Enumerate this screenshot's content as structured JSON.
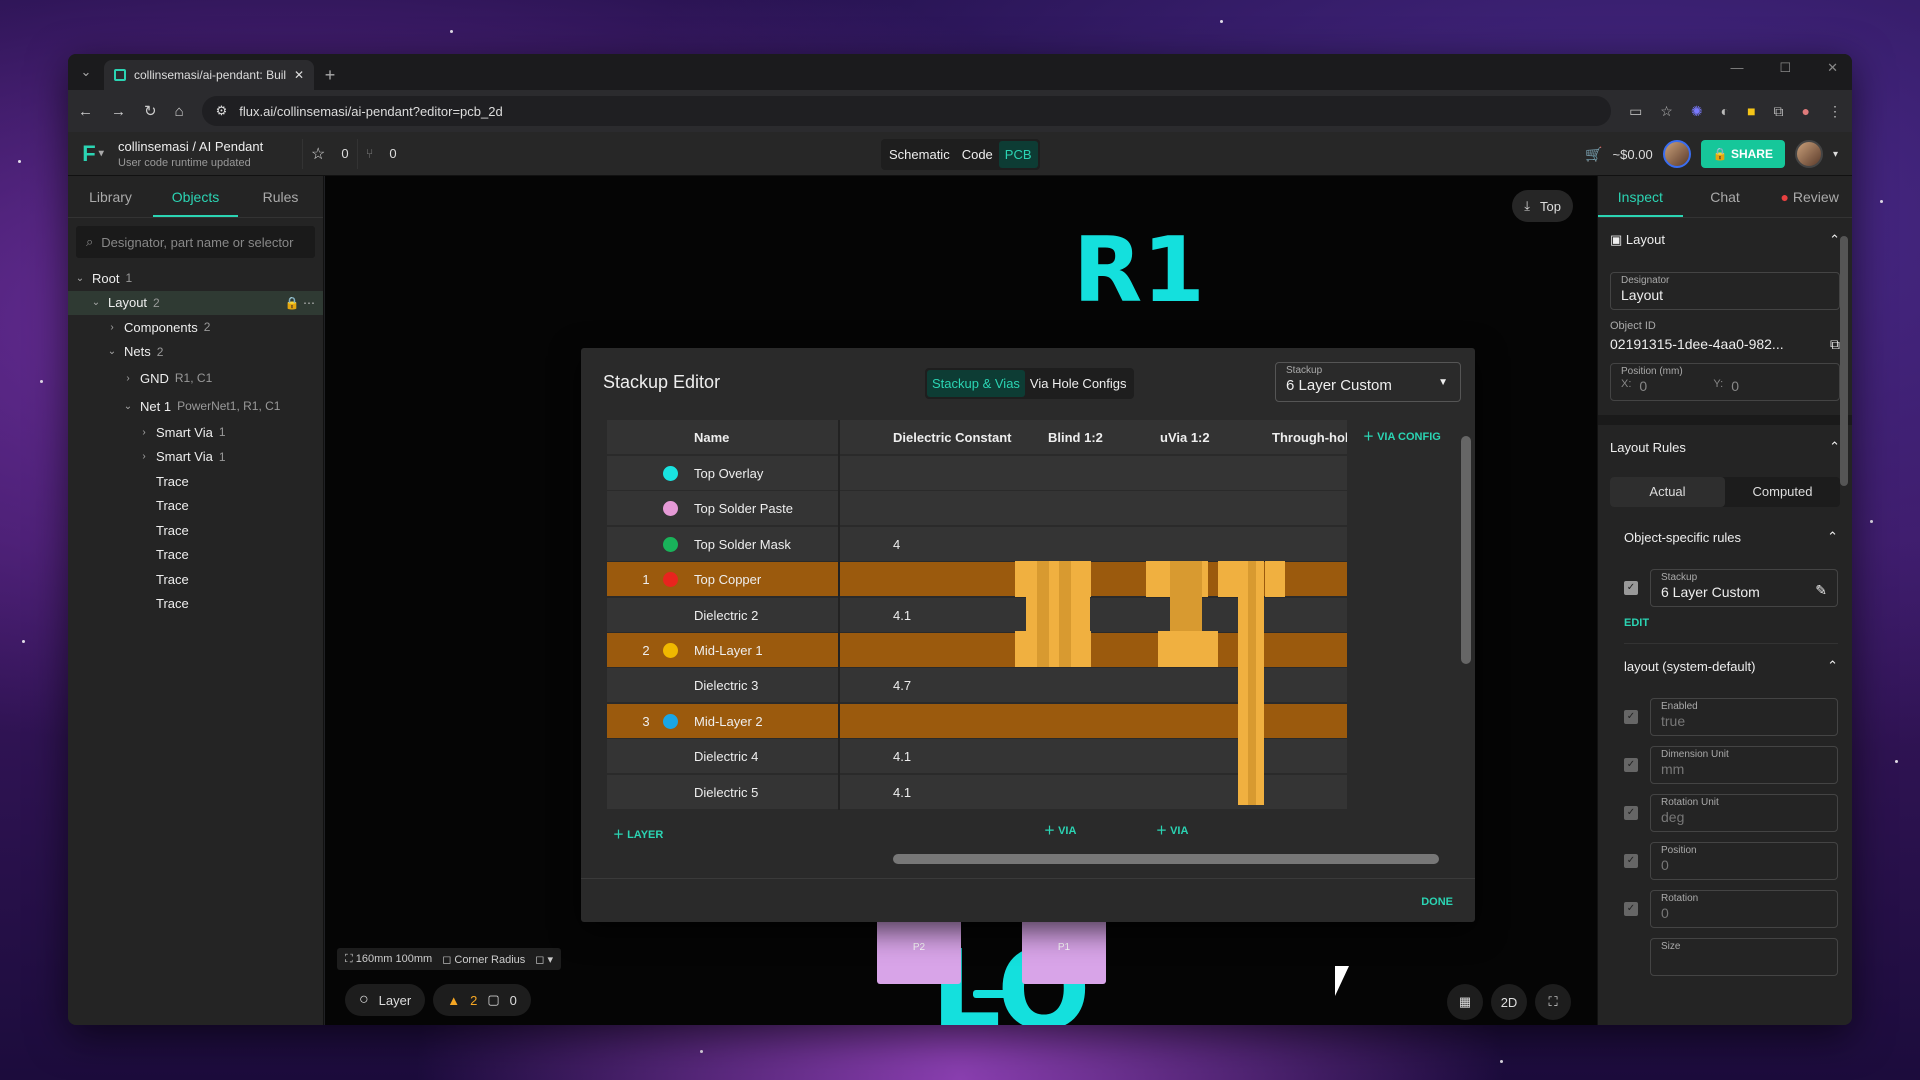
{
  "browser": {
    "tab_title": "collinsemasi/ai-pendant: Build",
    "url": "flux.ai/collinsemasi/ai-pendant?editor=pcb_2d"
  },
  "app": {
    "project_title": "collinsemasi / AI Pendant",
    "project_status": "User code runtime updated",
    "stars": "0",
    "forks": "0",
    "views": [
      "Schematic",
      "Code",
      "PCB"
    ],
    "active_view": "PCB",
    "cart_total": "~$0.00",
    "share_label": "SHARE"
  },
  "left_panel": {
    "tabs": [
      "Library",
      "Objects",
      "Rules"
    ],
    "active_tab": "Objects",
    "search_placeholder": "Designator, part name or selector",
    "tree": [
      {
        "label": "Root",
        "count": "1"
      },
      {
        "label": "Layout",
        "count": "2"
      },
      {
        "label": "Components",
        "count": "2"
      },
      {
        "label": "Nets",
        "count": "2"
      },
      {
        "label": "GND",
        "count": "R1, C1"
      },
      {
        "label": "Net 1",
        "count": "PowerNet1, R1, C1"
      },
      {
        "label": "Smart Via",
        "count": "1"
      },
      {
        "label": "Smart Via",
        "count": "1"
      },
      {
        "label": "Trace",
        "count": ""
      },
      {
        "label": "Trace",
        "count": ""
      },
      {
        "label": "Trace",
        "count": ""
      },
      {
        "label": "Trace",
        "count": ""
      },
      {
        "label": "Trace",
        "count": ""
      },
      {
        "label": "Trace",
        "count": ""
      }
    ]
  },
  "canvas": {
    "big_label_top": "R1",
    "big_label_bottom": "LO",
    "pad_left": "P2",
    "pad_right": "P1",
    "view_side": "Top",
    "board_size": "160mm 100mm",
    "corner_radius": "Corner Radius",
    "layer_label": "Layer",
    "warnings": "2",
    "comments": "0",
    "mode_2d": "2D"
  },
  "stackup_editor": {
    "title": "Stackup Editor",
    "tabs": [
      "Stackup & Vias",
      "Via Hole Configs"
    ],
    "active_tab": "Stackup & Vias",
    "stackup_label": "Stackup",
    "stackup_value": "6 Layer Custom",
    "columns": [
      "Name",
      "Dielectric Constant",
      "Blind 1:2",
      "uVia 1:2",
      "Through-hole"
    ],
    "rows": [
      {
        "num": "",
        "color": "#19e3e0",
        "name": "Top Overlay",
        "dc": "",
        "copper": false
      },
      {
        "num": "",
        "color": "#e59ad6",
        "name": "Top Solder Paste",
        "dc": "",
        "copper": false
      },
      {
        "num": "",
        "color": "#19b35a",
        "name": "Top Solder Mask",
        "dc": "4",
        "copper": false
      },
      {
        "num": "1",
        "color": "#e8241e",
        "name": "Top Copper",
        "dc": "",
        "copper": true
      },
      {
        "num": "",
        "color": "",
        "name": "Dielectric 2",
        "dc": "4.1",
        "copper": false
      },
      {
        "num": "2",
        "color": "#f0b800",
        "name": "Mid-Layer 1",
        "dc": "",
        "copper": true
      },
      {
        "num": "",
        "color": "",
        "name": "Dielectric 3",
        "dc": "4.7",
        "copper": false
      },
      {
        "num": "3",
        "color": "#1aa6e6",
        "name": "Mid-Layer 2",
        "dc": "",
        "copper": true
      },
      {
        "num": "",
        "color": "",
        "name": "Dielectric 4",
        "dc": "4.1",
        "copper": false
      },
      {
        "num": "",
        "color": "",
        "name": "Dielectric 5",
        "dc": "4.1",
        "copper": false
      }
    ],
    "via_config_label": "VIA CONFIG",
    "add_layer_label": "LAYER",
    "add_via_label": "VIA",
    "done_label": "DONE"
  },
  "right_panel": {
    "tabs": [
      "Inspect",
      "Chat",
      "Review"
    ],
    "active_tab": "Inspect",
    "layout_section": "Layout",
    "designator_label": "Designator",
    "designator_value": "Layout",
    "object_id_label": "Object ID",
    "object_id_value": "02191315-1dee-4aa0-982...",
    "position_label": "Position (mm)",
    "pos_x_label": "X:",
    "pos_x": "0",
    "pos_y_label": "Y:",
    "pos_y": "0",
    "layout_rules": "Layout Rules",
    "rules_tabs": [
      "Actual",
      "Computed"
    ],
    "object_rules": "Object-specific rules",
    "stackup_label": "Stackup",
    "stackup_value": "6 Layer Custom",
    "edit_label": "EDIT",
    "system_default": "layout (system-default)",
    "defaults": [
      {
        "label": "Enabled",
        "value": "true"
      },
      {
        "label": "Dimension Unit",
        "value": "mm"
      },
      {
        "label": "Rotation Unit",
        "value": "deg"
      },
      {
        "label": "Position",
        "value": "0"
      },
      {
        "label": "Rotation",
        "value": "0"
      },
      {
        "label": "Size",
        "value": ""
      }
    ]
  }
}
